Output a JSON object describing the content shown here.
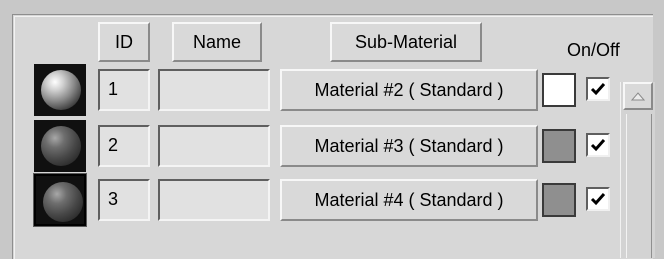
{
  "header": {
    "id_label": "ID",
    "name_label": "Name",
    "submaterial_label": "Sub-Material",
    "onoff_label": "On/Off"
  },
  "rows": [
    {
      "id": "1",
      "name": "",
      "material": "Material #2  ( Standard )",
      "color": "#ffffff",
      "on": true,
      "selected": false,
      "preview": "light-sphere"
    },
    {
      "id": "2",
      "name": "",
      "material": "Material #3  ( Standard )",
      "color": "#8f8f8f",
      "on": true,
      "selected": false,
      "preview": "dark-sphere"
    },
    {
      "id": "3",
      "name": "",
      "material": "Material #4  ( Standard )",
      "color": "#8f8f8f",
      "on": true,
      "selected": true,
      "preview": "dark-sphere"
    }
  ],
  "icons": {
    "checkmark": "check-icon",
    "scroll_up": "arrow-up-icon"
  }
}
